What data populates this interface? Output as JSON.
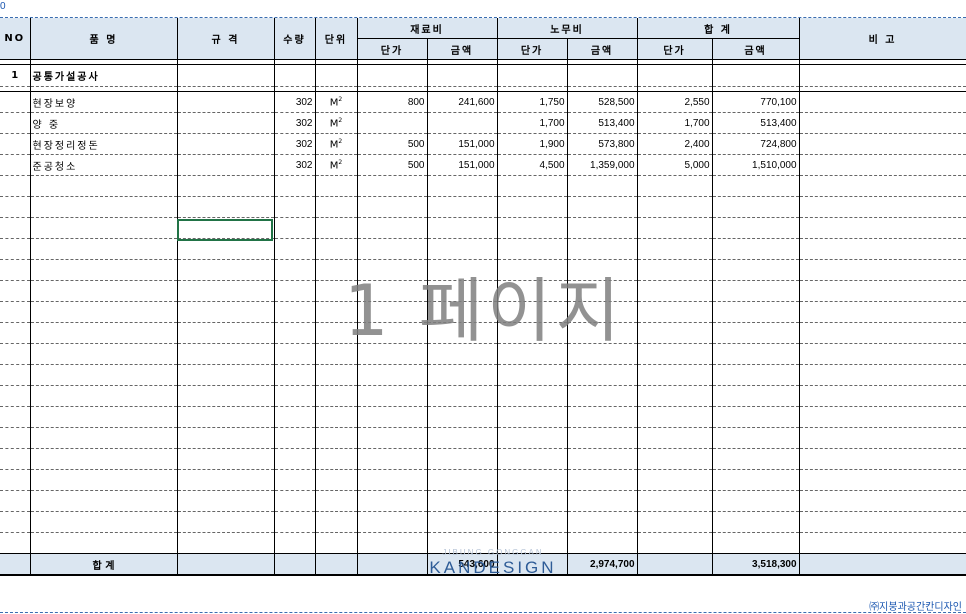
{
  "corner_label": "0",
  "headers": {
    "no": "NO",
    "item": "품      명",
    "spec": "규  격",
    "qty": "수량",
    "unit": "단위",
    "material": "재료비",
    "labor": "노무비",
    "total": "합 계",
    "note": "비  고",
    "unit_price": "단가",
    "amount": "금액"
  },
  "section": {
    "no": "1",
    "title": "공통가설공사"
  },
  "rows": [
    {
      "name": "현장보양",
      "qty": "302",
      "unit": "M",
      "mat_price": "800",
      "mat_amount": "241,600",
      "lab_price": "1,750",
      "lab_amount": "528,500",
      "tot_price": "2,550",
      "tot_amount": "770,100"
    },
    {
      "name": "양    중",
      "qty": "302",
      "unit": "M",
      "mat_price": "",
      "mat_amount": "",
      "lab_price": "1,700",
      "lab_amount": "513,400",
      "tot_price": "1,700",
      "tot_amount": "513,400"
    },
    {
      "name": "현장정리정돈",
      "qty": "302",
      "unit": "M",
      "mat_price": "500",
      "mat_amount": "151,000",
      "lab_price": "1,900",
      "lab_amount": "573,800",
      "tot_price": "2,400",
      "tot_amount": "724,800"
    },
    {
      "name": "준공청소",
      "qty": "302",
      "unit": "M",
      "mat_price": "500",
      "mat_amount": "151,000",
      "lab_price": "4,500",
      "lab_amount": "1,359,000",
      "tot_price": "5,000",
      "tot_amount": "1,510,000"
    }
  ],
  "unit_sup": "2",
  "total_row": {
    "label": "합      계",
    "mat_amount": "543,600",
    "lab_amount": "2,974,700",
    "tot_amount": "3,518,300"
  },
  "watermark": "1 페이지",
  "logo": {
    "top": "JIBUNG  GONGGAN",
    "main": "KANDESIGN"
  },
  "brand": "㈜지붕과공간칸디자인"
}
